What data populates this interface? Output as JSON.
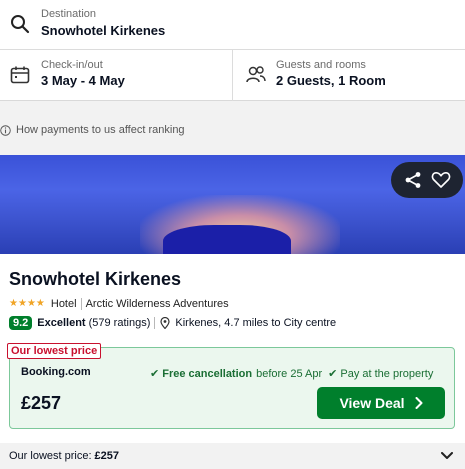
{
  "search": {
    "destination_label": "Destination",
    "destination_value": "Snowhotel Kirkenes",
    "checkin_label": "Check-in/out",
    "checkin_value": "3 May - 4 May",
    "guests_label": "Guests and rooms",
    "guests_value": "2 Guests, 1 Room"
  },
  "payments_note": "How payments to us affect ranking",
  "hotel": {
    "name": "Snowhotel Kirkenes",
    "stars": 4,
    "type": "Hotel",
    "category": "Arctic Wilderness Adventures",
    "rating_score": "9.2",
    "rating_word": "Excellent",
    "rating_count": "(579 ratings)",
    "location": "Kirkenes, 4.7 miles to City centre"
  },
  "deal": {
    "badge": "Our lowest price",
    "provider": "Booking.com",
    "free_cancel": "Free cancellation",
    "free_cancel_date": "before 25 Apr",
    "pay_at_property": "Pay at the property",
    "price": "£257",
    "button_label": "View Deal"
  },
  "footer": {
    "label": "Our lowest price:",
    "value": "£257"
  },
  "colors": {
    "accent_green": "#007f2c",
    "badge_red": "#c8102e",
    "star_orange": "#f0a426"
  },
  "icons": {
    "search": "search-icon",
    "calendar": "calendar-icon",
    "guests": "guests-icon",
    "info": "info-icon",
    "share": "share-icon",
    "heart": "heart-icon",
    "pin": "pin-icon",
    "chevron_right": "chevron-right-icon",
    "chevron_down": "chevron-down-icon"
  }
}
